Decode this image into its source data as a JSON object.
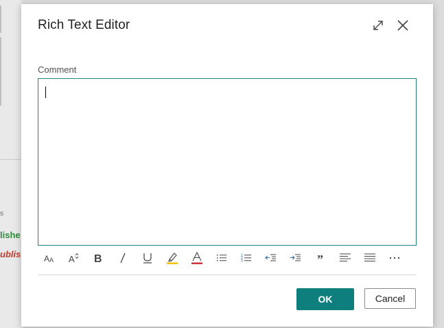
{
  "dialog": {
    "title": "Rich Text Editor",
    "field_label": "Comment",
    "editor_value": ""
  },
  "background": {
    "small_text": "s",
    "status_green": "lishe",
    "status_red": "ublis"
  },
  "toolbar": {
    "items": [
      {
        "name": "font-size-icon"
      },
      {
        "name": "superscript-icon"
      },
      {
        "name": "bold-icon"
      },
      {
        "name": "italic-icon"
      },
      {
        "name": "underline-icon"
      },
      {
        "name": "highlight-icon"
      },
      {
        "name": "font-color-icon"
      },
      {
        "name": "bullet-list-icon"
      },
      {
        "name": "numbered-list-icon"
      },
      {
        "name": "decrease-indent-icon"
      },
      {
        "name": "increase-indent-icon"
      },
      {
        "name": "quote-icon"
      },
      {
        "name": "align-left-icon"
      },
      {
        "name": "align-justify-icon"
      },
      {
        "name": "more-icon"
      }
    ]
  },
  "buttons": {
    "ok_label": "OK",
    "cancel_label": "Cancel"
  },
  "colors": {
    "accent": "#0f7f7e",
    "highlight": "#f2c200",
    "font_color": "#d13438",
    "indent_accent": "#2b6cb0"
  }
}
